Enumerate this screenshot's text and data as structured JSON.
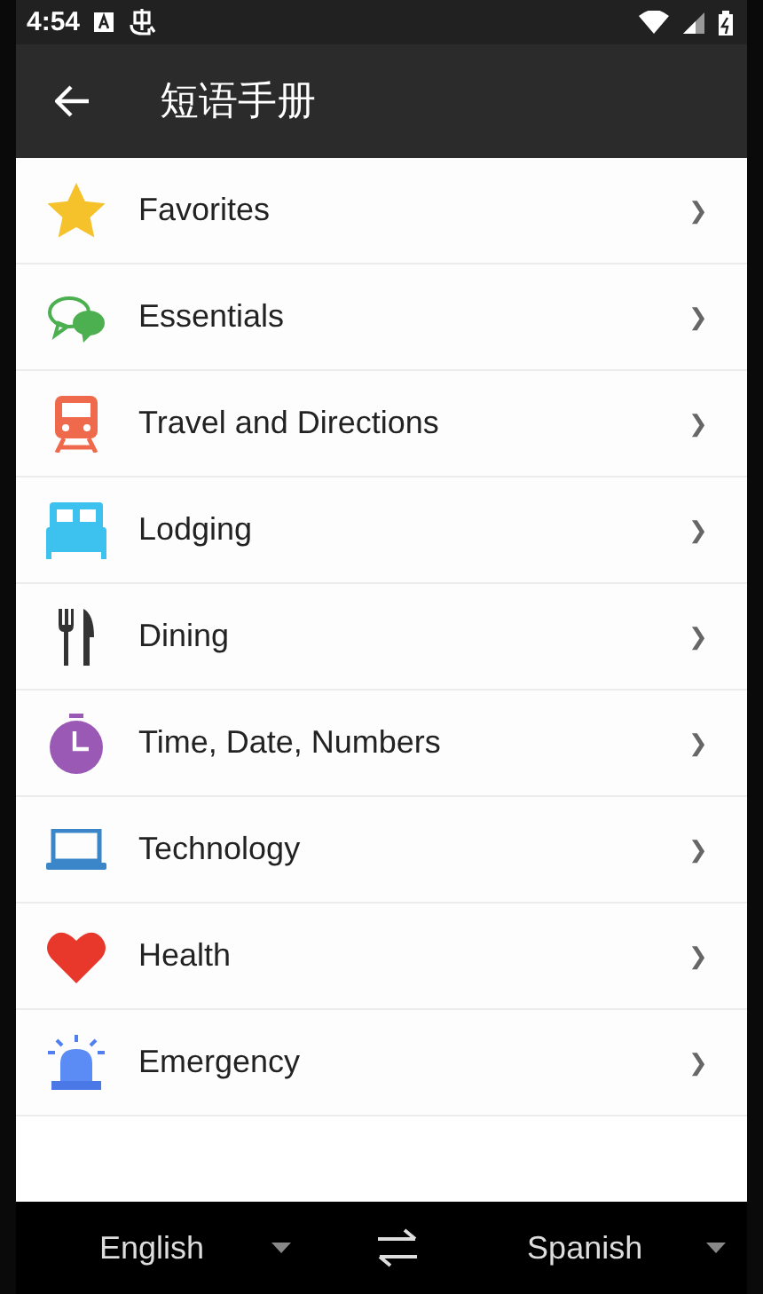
{
  "status_bar": {
    "time": "4:54"
  },
  "toolbar": {
    "title": "短语手册"
  },
  "categories": [
    {
      "kind": "favorites",
      "label": "Favorites",
      "chevron": "❯"
    },
    {
      "kind": "essentials",
      "label": "Essentials",
      "chevron": "❯"
    },
    {
      "kind": "travel",
      "label": "Travel and Directions",
      "chevron": "❯"
    },
    {
      "kind": "lodging",
      "label": "Lodging",
      "chevron": "❯"
    },
    {
      "kind": "dining",
      "label": "Dining",
      "chevron": "❯"
    },
    {
      "kind": "time",
      "label": "Time, Date, Numbers",
      "chevron": "❯"
    },
    {
      "kind": "technology",
      "label": "Technology",
      "chevron": "❯"
    },
    {
      "kind": "health",
      "label": "Health",
      "chevron": "❯"
    },
    {
      "kind": "emergency",
      "label": "Emergency",
      "chevron": "❯"
    }
  ],
  "language_bar": {
    "source": "English",
    "target": "Spanish"
  }
}
